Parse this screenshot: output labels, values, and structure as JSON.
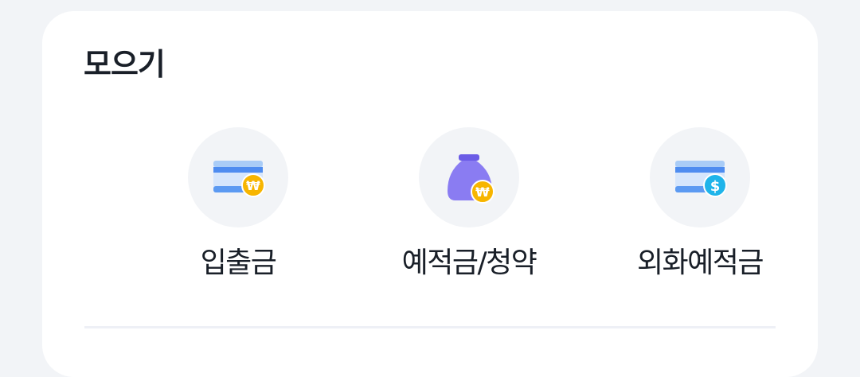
{
  "section": {
    "title": "모으기"
  },
  "menu": {
    "items": [
      {
        "label": "입출금",
        "icon": "card-won-icon"
      },
      {
        "label": "예적금/청약",
        "icon": "money-bag-won-icon"
      },
      {
        "label": "외화예적금",
        "icon": "card-dollar-icon"
      }
    ]
  },
  "colors": {
    "background": "#f2f4f7",
    "card": "#ffffff",
    "title_text": "#191f28",
    "icon_circle": "#f2f4f7",
    "card_blue": "#4e8cf0",
    "card_light": "#cfe2fb",
    "bag_purple": "#8a7cf2",
    "coin_gold": "#f7b500",
    "coin_cyan": "#1fb4ea"
  }
}
